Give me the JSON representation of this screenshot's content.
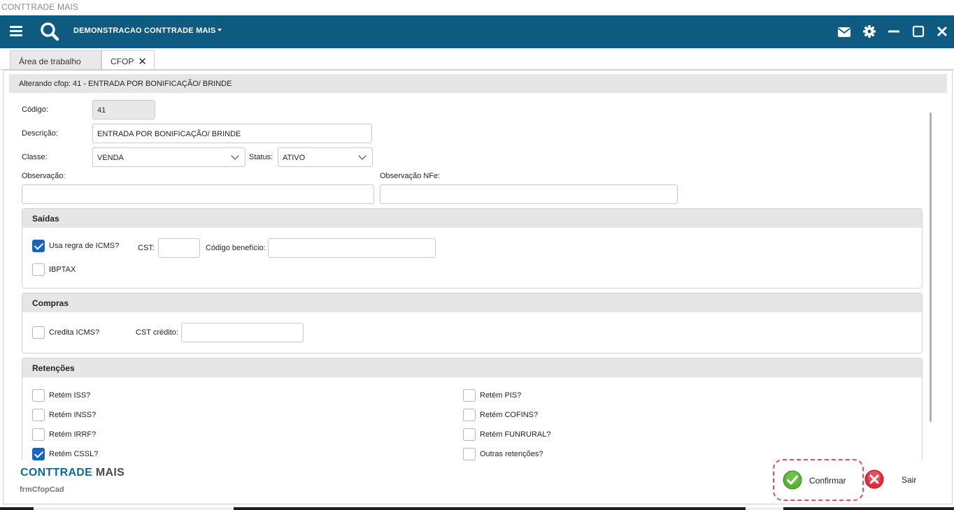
{
  "window": {
    "title": "CONTTRADE MAIS"
  },
  "topbar": {
    "company": "DEMONSTRACAO CONTTRADE MAIS"
  },
  "tabs": [
    {
      "label": "Área de trabalho"
    },
    {
      "label": "CFOP",
      "close": "✕"
    }
  ],
  "form": {
    "header": "Alterando cfop: 41 - ENTRADA POR BONIFICAÇÃO/ BRINDE",
    "codigo_label": "Código:",
    "codigo_value": "41",
    "descricao_label": "Descrição:",
    "descricao_value": "ENTRADA POR BONIFICAÇÃO/ BRINDE",
    "classe_label": "Classe:",
    "classe_value": "VENDA",
    "status_label": "Status:",
    "status_value": "ATIVO",
    "observacao_label": "Observação:",
    "observacao_value": "",
    "observacao_nfe_label": "Observação NFe:",
    "observacao_nfe_value": ""
  },
  "saidas": {
    "title": "Saídas",
    "usa_regra_icms": {
      "label": "Usa regra de ICMS?",
      "checked": true
    },
    "cst_label": "CST:",
    "cst_value": "",
    "codigo_beneficio_label": "Código benefício:",
    "codigo_beneficio_value": "",
    "ibptax": {
      "label": "IBPTAX",
      "checked": false
    }
  },
  "compras": {
    "title": "Compras",
    "credita_icms": {
      "label": "Credita ICMS?",
      "checked": false
    },
    "cst_credito_label": "CST crédito:",
    "cst_credito_value": ""
  },
  "retencoes": {
    "title": "Retenções",
    "left": [
      {
        "label": "Retém ISS?",
        "checked": false
      },
      {
        "label": "Retém INSS?",
        "checked": false
      },
      {
        "label": "Retém IRRF?",
        "checked": false
      },
      {
        "label": "Retém CSSL?",
        "checked": true
      }
    ],
    "right": [
      {
        "label": "Retém PIS?",
        "checked": false
      },
      {
        "label": "Retém COFINS?",
        "checked": false
      },
      {
        "label": "Retém FUNRURAL?",
        "checked": false
      },
      {
        "label": "Outras retenções?",
        "checked": false
      }
    ]
  },
  "footer": {
    "brand_part1": "CONTTRADE",
    "brand_part2": "MAIS",
    "form_name": "frmCfopCad",
    "confirm_label": "Confirmar",
    "exit_label": "Sair"
  },
  "colors": {
    "topbar": "#0e5a80",
    "checkbox_checked": "#1565c0",
    "confirm_icon": "#5cb03a",
    "exit_icon": "#d8303a",
    "highlight_dashed": "#e0505a"
  }
}
